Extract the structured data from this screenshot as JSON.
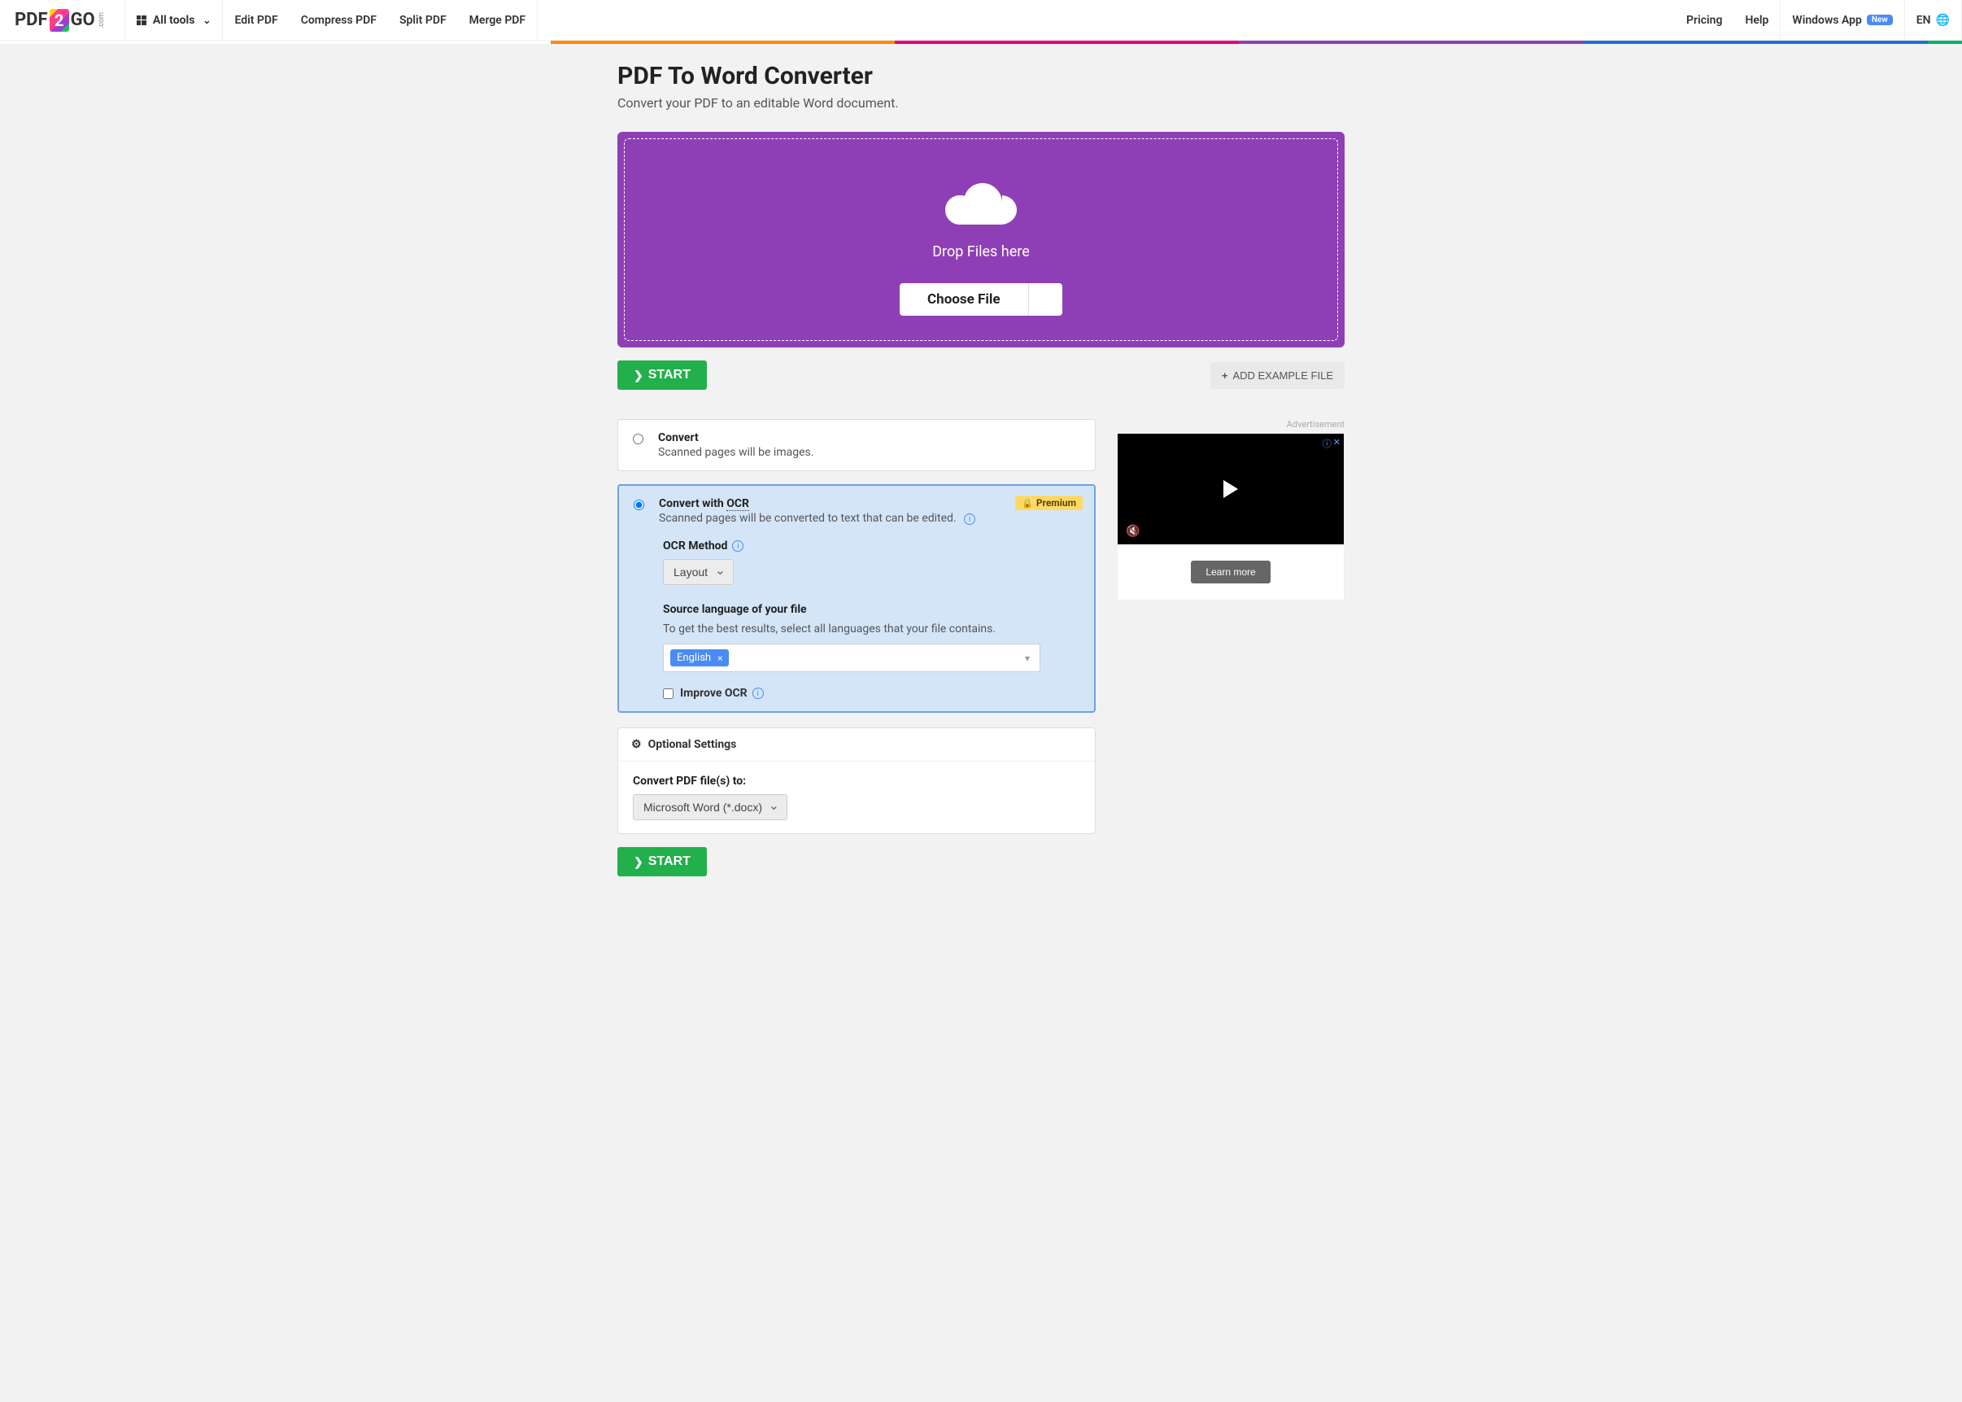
{
  "header": {
    "logo_pre": "PDF",
    "logo_mid": "2",
    "logo_post": "GO",
    "logo_com": ".com",
    "all_tools": "All tools",
    "nav": {
      "edit": "Edit PDF",
      "compress": "Compress PDF",
      "split": "Split PDF",
      "merge": "Merge PDF"
    },
    "pricing": "Pricing",
    "help": "Help",
    "windows_app": "Windows App",
    "new_badge": "New",
    "lang": "EN"
  },
  "page": {
    "title": "PDF To Word Converter",
    "subtitle": "Convert your PDF to an editable Word document."
  },
  "dropzone": {
    "text": "Drop Files here",
    "choose": "Choose File"
  },
  "actions": {
    "start": "START",
    "add_example": "ADD EXAMPLE FILE"
  },
  "options": {
    "convert": {
      "title": "Convert",
      "desc": "Scanned pages will be images."
    },
    "ocr": {
      "title_pre": "Convert with ",
      "title_ocr": "OCR",
      "desc": "Scanned pages will be converted to text that can be edited.",
      "premium": "Premium",
      "method_label": "OCR Method",
      "method_value": "Layout",
      "lang_label": "Source language of your file",
      "lang_desc": "To get the best results, select all languages that your file contains.",
      "lang_tag": "English",
      "improve": "Improve OCR"
    },
    "optional": {
      "header": "Optional Settings",
      "convert_to_label": "Convert PDF file(s) to:",
      "convert_to_value": "Microsoft Word (*.docx)"
    }
  },
  "ad": {
    "label": "Advertisement",
    "cta": "Learn more"
  }
}
